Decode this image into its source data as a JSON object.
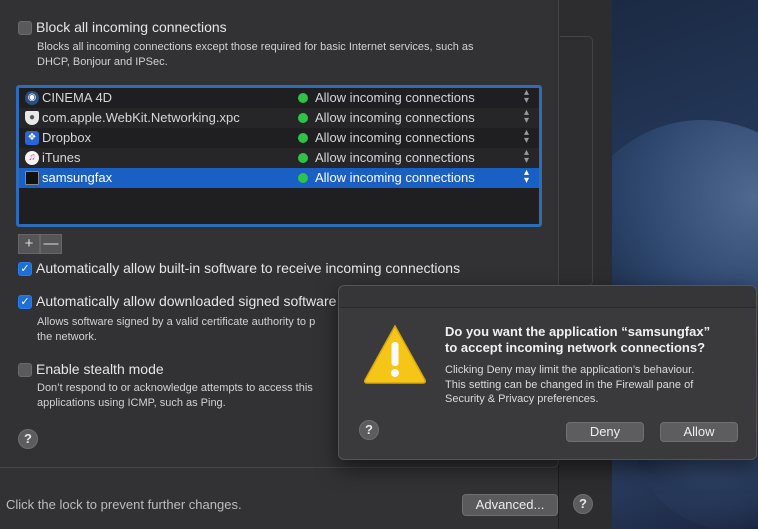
{
  "block_all": {
    "label": "Block all incoming connections",
    "checked": false,
    "description_line1": "Blocks all incoming connections except those required for basic Internet services, such as",
    "description_line2": "DHCP, Bonjour and IPSec."
  },
  "app_list": [
    {
      "name": "CINEMA 4D",
      "icon": "cinema4d-icon",
      "status": "Allow incoming connections",
      "status_color": "#2ec44a"
    },
    {
      "name": "com.apple.WebKit.Networking.xpc",
      "icon": "shield-icon",
      "status": "Allow incoming connections",
      "status_color": "#2ec44a"
    },
    {
      "name": "Dropbox",
      "icon": "dropbox-icon",
      "status": "Allow incoming connections",
      "status_color": "#2ec44a"
    },
    {
      "name": "iTunes",
      "icon": "itunes-icon",
      "status": "Allow incoming connections",
      "status_color": "#2ec44a"
    },
    {
      "name": "samsungfax",
      "icon": "terminal-icon",
      "status": "Allow incoming connections",
      "status_color": "#2ec44a",
      "selected": true
    }
  ],
  "list_buttons": {
    "add": "+",
    "remove": "—"
  },
  "auto_builtin": {
    "label": "Automatically allow built-in software to receive incoming connections",
    "checked": true
  },
  "auto_signed": {
    "label": "Automatically allow downloaded signed software t",
    "checked": true,
    "description_line1": "Allows software signed by a valid certificate authority to p",
    "description_line2": "the network."
  },
  "stealth": {
    "label": "Enable stealth mode",
    "checked": false,
    "description_line1": "Don’t respond to or acknowledge attempts to access this",
    "description_line2": "applications using ICMP, such as Ping."
  },
  "help_label": "?",
  "footer": {
    "lock_text": "Click the lock to prevent further changes.",
    "advanced_label": "Advanced..."
  },
  "dialog": {
    "title_line1": "Do you want the application “samsungfax”",
    "title_line2": "to accept incoming network connections?",
    "body_line1": "Clicking Deny may limit the application’s behaviour.",
    "body_line2": "This setting can be changed in the Firewall pane of",
    "body_line3": "Security & Privacy preferences.",
    "deny_label": "Deny",
    "allow_label": "Allow",
    "warning_color": "#f5c518"
  }
}
